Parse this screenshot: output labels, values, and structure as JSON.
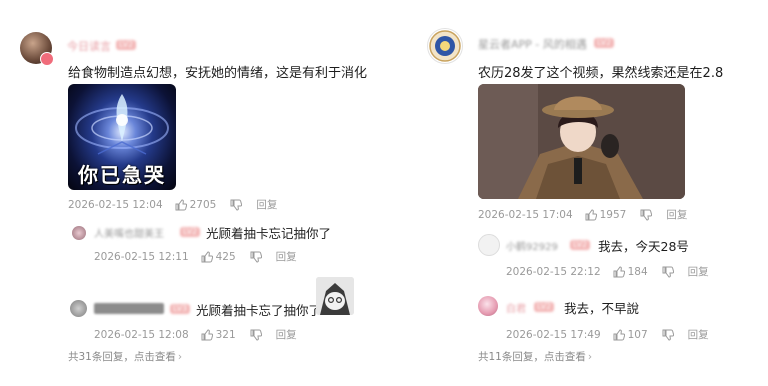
{
  "left": {
    "main": {
      "username": "今日读言",
      "level_badge": "LV2",
      "text": "给食物制造点幻想，安抚她的情绪，这是有利于消化",
      "meme_caption": "你已急哭",
      "date": "2026-02-15 12:04",
      "likes": "2705",
      "reply_label": "回复"
    },
    "reply1": {
      "username": "人美嘴也甜美王",
      "level_badge": "LV2",
      "text": "光顾着抽卡忘记抽你了",
      "date": "2026-02-15 12:11",
      "likes": "425",
      "reply_label": "回复"
    },
    "reply2": {
      "level_badge": "LV3",
      "text": "光顾着抽卡忘了抽你了",
      "date": "2026-02-15 12:08",
      "likes": "321",
      "reply_label": "回复"
    },
    "footer": "共31条回复，点击查看"
  },
  "right": {
    "main": {
      "username": "星云者APP - 风的相遇",
      "level_badge": "LV2",
      "text": "农历28发了这个视频，果然线索还是在2.8",
      "date": "2026-02-15 17:04",
      "likes": "1957",
      "reply_label": "回复"
    },
    "reply1": {
      "username": "小鹤92929",
      "level_badge": "LV2",
      "text": "我去，今天28号",
      "date": "2026-02-15 22:12",
      "likes": "184",
      "reply_label": "回复"
    },
    "reply2": {
      "username": "白君",
      "level_badge": "LV2",
      "text": "我去，不早說",
      "date": "2026-02-15 17:49",
      "likes": "107",
      "reply_label": "回复"
    },
    "footer": "共11条回复，点击查看"
  }
}
